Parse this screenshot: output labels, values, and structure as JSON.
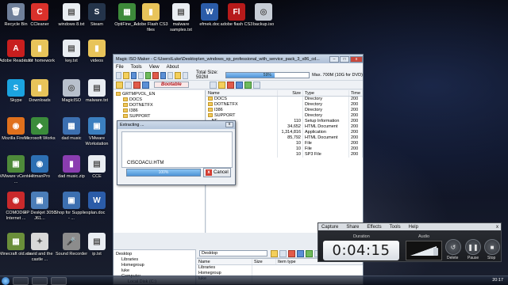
{
  "desktop": {
    "icons": [
      {
        "label": "Recycle Bin",
        "glyph": "🗑",
        "color": "#6f7f99"
      },
      {
        "label": "CCleaner",
        "glyph": "C",
        "color": "#d9312b"
      },
      {
        "label": "windows 8.txt",
        "glyph": "▤",
        "color": "#e9edf2"
      },
      {
        "label": "Steam",
        "glyph": "S",
        "color": "#24344a"
      },
      {
        "label": "OptiFine_1...",
        "glyph": "▦",
        "color": "#3d8a3a"
      },
      {
        "label": "Adobe Flash CS3 files",
        "glyph": "▮",
        "color": "#e8c45a"
      },
      {
        "label": "malware samples.txt",
        "glyph": "▤",
        "color": "#e9edf2"
      },
      {
        "label": "efmek.doc",
        "glyph": "W",
        "color": "#2b5ca8"
      },
      {
        "label": "adobe flash CS3",
        "glyph": "Fl",
        "color": "#b61a1a"
      },
      {
        "label": "backup.iso",
        "glyph": "◎",
        "color": "#c7cdd6"
      },
      {
        "label": "Adobe Reader XI",
        "glyph": "A",
        "color": "#c81e1e"
      },
      {
        "label": "tutor homework",
        "glyph": "▮",
        "color": "#e8c45a"
      },
      {
        "label": "key.txt",
        "glyph": "▤",
        "color": "#e9edf2"
      },
      {
        "label": "videos",
        "glyph": "▮",
        "color": "#e8c45a"
      },
      {
        "label": "Skype",
        "glyph": "S",
        "color": "#1ba3e0"
      },
      {
        "label": "Downloads",
        "glyph": "▮",
        "color": "#e8c45a"
      },
      {
        "label": "MagicISO",
        "glyph": "◎",
        "color": "#b8c0cc"
      },
      {
        "label": "malware.txt",
        "glyph": "▤",
        "color": "#e9edf2"
      },
      {
        "label": "Mozilla Firefox",
        "glyph": "◉",
        "color": "#e0701c"
      },
      {
        "label": "Microsoft Works",
        "glyph": "◆",
        "color": "#3b8c3b"
      },
      {
        "label": "dad music",
        "glyph": "▦",
        "color": "#3c6fb0"
      },
      {
        "label": "VMware Workstation",
        "glyph": "▣",
        "color": "#3b7fbf"
      },
      {
        "label": "VMware vCenter ...",
        "glyph": "▣",
        "color": "#4e8a3a"
      },
      {
        "label": "HitmanPro",
        "glyph": "◉",
        "color": "#2d6fb3"
      },
      {
        "label": "dad music.zip",
        "glyph": "▮",
        "color": "#8a3db0"
      },
      {
        "label": "CCE",
        "glyph": "▤",
        "color": "#e9edf2"
      },
      {
        "label": "COMODO Internet ...",
        "glyph": "◉",
        "color": "#c9292b"
      },
      {
        "label": "HP Deskjet 3050 J61...",
        "glyph": "▣",
        "color": "#4b7db8"
      },
      {
        "label": "Shop for Supplies - ...",
        "glyph": "▣",
        "color": "#3c6fb0"
      },
      {
        "label": "plan.doc",
        "glyph": "W",
        "color": "#2b5ca8"
      },
      {
        "label": "Minecraft old.exe",
        "glyph": "▦",
        "color": "#6a8f3a"
      },
      {
        "label": "david and the castle ...",
        "glyph": "✦",
        "color": "#d8d8d8"
      },
      {
        "label": "Sound Recorder",
        "glyph": "🎤",
        "color": "#8c8c8c"
      },
      {
        "label": "ip.txt",
        "glyph": "▤",
        "color": "#e9edf2"
      }
    ]
  },
  "magiciso": {
    "title": "Magic ISO Maker - C:\\Users\\Luke\\Desktop\\en_windows_xp_professional_with_service_pack_3_x86_cd...",
    "menu": [
      "File",
      "Tools",
      "View",
      "About"
    ],
    "total_size_label": "Total Size: 592M",
    "size_bar_text": "59%",
    "size_fill_fraction": 0.59,
    "max_size_label": "Max. 700M (10G for DVD)",
    "bootable_label": "Bootable",
    "tree": [
      "GRTMPVOL_EN",
      "DOCS",
      "DOTNETFX",
      "I386",
      "SUPPORT"
    ],
    "columns": [
      "Name",
      "Size",
      "Type",
      "Time"
    ],
    "rows": [
      {
        "name": "DOCS",
        "size": "",
        "type": "Directory",
        "time": "200"
      },
      {
        "name": "DOTNETFX",
        "size": "",
        "type": "Directory",
        "time": "200"
      },
      {
        "name": "I386",
        "size": "",
        "type": "Directory",
        "time": "200"
      },
      {
        "name": "SUPPORT",
        "size": "",
        "type": "Directory",
        "time": "200"
      },
      {
        "name": "...NF",
        "size": "110",
        "type": "Setup Information",
        "time": "200"
      },
      {
        "name": "...",
        "size": "34,652",
        "type": "HTML Document",
        "time": "200"
      },
      {
        "name": "...",
        "size": "1,314,816",
        "type": "Application",
        "time": "200"
      },
      {
        "name": "...TM",
        "size": "85,792",
        "type": "HTML Document",
        "time": "200"
      },
      {
        "name": "...",
        "size": "10",
        "type": "File",
        "time": "200"
      },
      {
        "name": "...",
        "size": "10",
        "type": "File",
        "time": "200"
      },
      {
        "name": "...D",
        "size": "10",
        "type": "SP3 File",
        "time": "200"
      }
    ],
    "local_tree": [
      "Desktop",
      "Libraries",
      "Homegroup",
      "luke",
      "Computer",
      "Local Disk (C:)"
    ],
    "local_path": "Desktop",
    "local_columns": [
      "Name",
      "Size",
      "Item type"
    ],
    "local_rows": [
      "Libraries",
      "Homegroup",
      "luke"
    ]
  },
  "extract_dialog": {
    "title": "Extracting ...",
    "close": "x",
    "file": "CISCOACU.HTM",
    "progress_text": "100%",
    "cancel_label": "Cancel"
  },
  "recorder": {
    "menu": [
      "Capture",
      "Share",
      "Effects",
      "Tools",
      "Help"
    ],
    "close": "x",
    "duration_label": "Duration",
    "audio_label": "Audio",
    "timer": "0:04:15",
    "buttons": [
      {
        "label": "Delete",
        "glyph": "↺"
      },
      {
        "label": "Pause",
        "glyph": "❚❚"
      },
      {
        "label": "Stop",
        "glyph": "■"
      }
    ]
  },
  "taskbar": {
    "clock": "20:17"
  }
}
